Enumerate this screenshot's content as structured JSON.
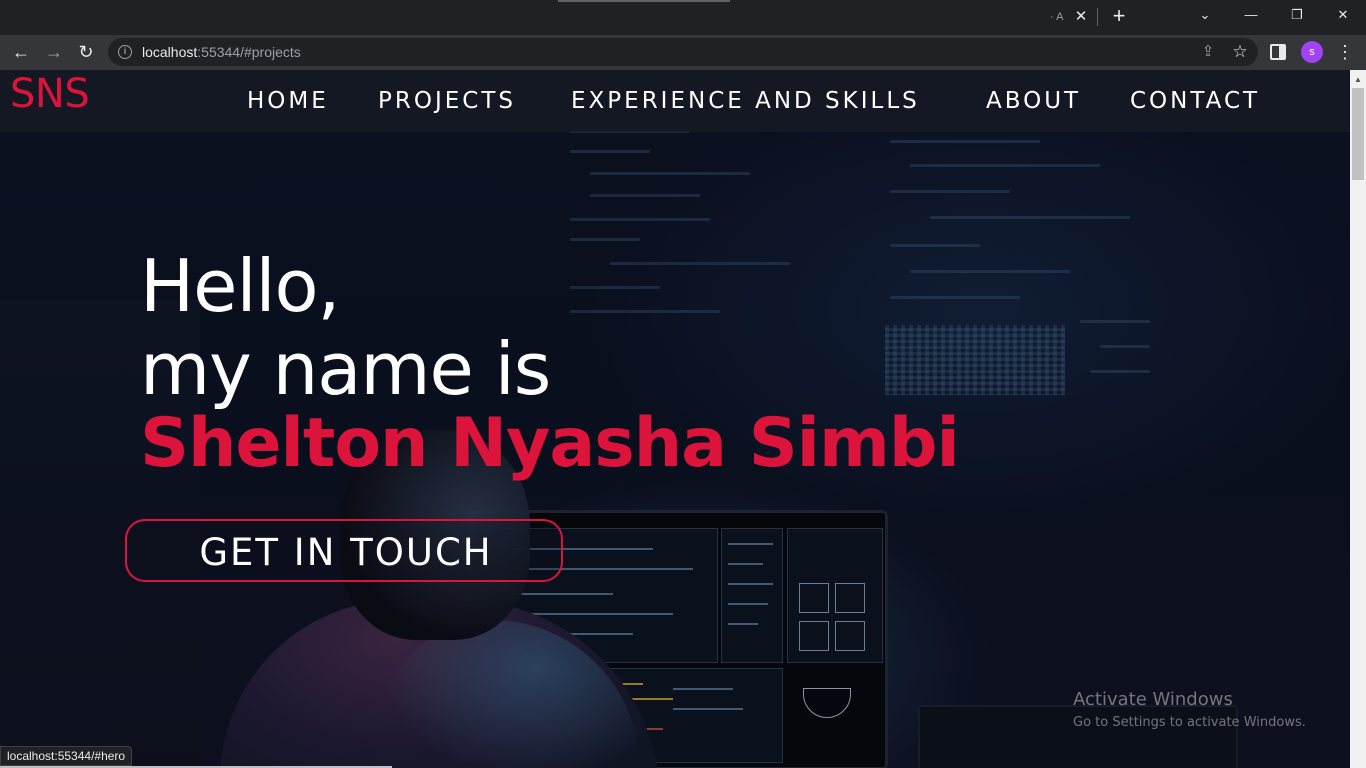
{
  "browser": {
    "tab_ghost_label": "· A",
    "tab_close_glyph": "✕",
    "new_tab_glyph": "+",
    "window_controls": {
      "dropdown": "⌄",
      "minimize": "—",
      "restore": "❐",
      "close": "✕"
    },
    "nav": {
      "back": "←",
      "forward": "→",
      "reload": "↻"
    },
    "url_host": "localhost",
    "url_rest": ":55344/#projects",
    "share_glyph": "⇪",
    "star_glyph": "☆",
    "profile_initial": "s",
    "menu_glyph": "⋮",
    "info_glyph": "i",
    "status_url": "localhost:55344/#hero"
  },
  "site": {
    "logo": "SNS",
    "nav": [
      {
        "label": "HOME"
      },
      {
        "label": "PROJECTS"
      },
      {
        "label": "EXPERIENCE AND SKILLS"
      },
      {
        "label": "ABOUT"
      },
      {
        "label": "CONTACT"
      }
    ],
    "hero": {
      "line1": "Hello,",
      "line2": "my name is",
      "name": "Shelton Nyasha Simbi",
      "cta": "GET IN TOUCH"
    },
    "accent_color": "#dc143c"
  },
  "os_watermark": {
    "title": "Activate Windows",
    "subtitle": "Go to Settings to activate Windows."
  }
}
